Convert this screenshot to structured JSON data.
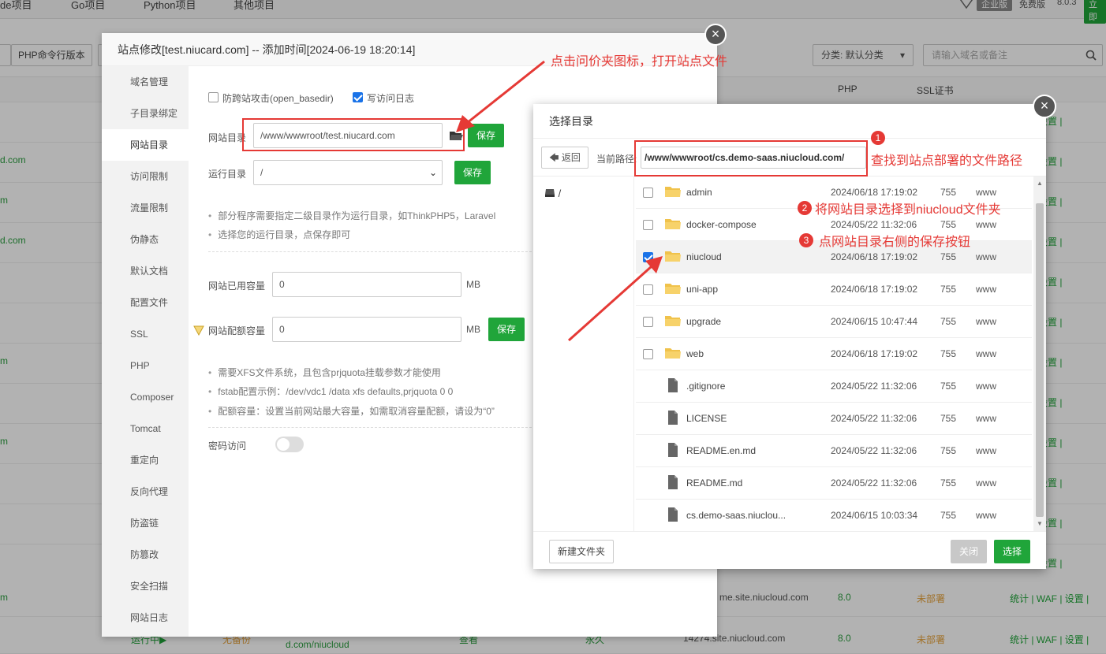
{
  "background": {
    "tabs": [
      "de项目",
      "Go项目",
      "Python项目",
      "其他项目"
    ],
    "edition_badge": "企业版",
    "edition_free": "免费版",
    "version": "8.0.3",
    "upgrade": "立即",
    "php_cli_button": "PHP命令行版本",
    "category_select": "分类: 默认分类",
    "search_placeholder": "请输入域名或备注",
    "col_php": "PHP",
    "col_ssl": "SSL证书",
    "domain_fragments": [
      "d.com",
      "m",
      "d.com",
      "m",
      "m"
    ],
    "row_actions": "WAF | 设置 |",
    "row_actions_full": "统计 | WAF | 设置 |",
    "row1": {
      "domain": "me.site.niucloud.com",
      "php": "8.0",
      "ssl": "未部署"
    },
    "row2": {
      "status": "运行中▶",
      "backup": "无备份",
      "path": "d.com/niucloud",
      "view": "查看",
      "expire": "永久",
      "domain": "14274.site.niucloud.com",
      "php": "8.0",
      "ssl": "未部署"
    },
    "left_m": "m"
  },
  "site_modal": {
    "title": "站点修改[test.niucard.com] -- 添加时间[2024-06-19 18:20:14]",
    "nav": [
      "域名管理",
      "子目录绑定",
      "网站目录",
      "访问限制",
      "流量限制",
      "伪静态",
      "默认文档",
      "配置文件",
      "SSL",
      "PHP",
      "Composer",
      "Tomcat",
      "重定向",
      "反向代理",
      "防盗链",
      "防篡改",
      "安全扫描",
      "网站日志"
    ],
    "active_nav": "网站目录",
    "open_basedir_label": "防跨站攻击(open_basedir)",
    "access_log_label": "写访问日志",
    "site_dir_label": "网站目录",
    "site_dir_value": "/www/wwwroot/test.niucard.com",
    "save": "保存",
    "run_dir_label": "运行目录",
    "run_dir_value": "/",
    "tips1": [
      "部分程序需要指定二级目录作为运行目录，如ThinkPHP5，Laravel",
      "选择您的运行目录，点保存即可"
    ],
    "used_label": "网站已用容量",
    "used_value": "0",
    "quota_label": "网站配额容量",
    "quota_value": "0",
    "unit": "MB",
    "tips2": [
      "需要XFS文件系统，且包含prjquota挂载参数才能使用",
      "fstab配置示例：/dev/vdc1 /data xfs defaults,prjquota 0 0",
      "配额容量：设置当前网站最大容量，如需取消容量配额，请设为“0”"
    ],
    "password_label": "密码访问"
  },
  "dir_modal": {
    "title": "选择目录",
    "back": "返回",
    "path_label": "当前路径:",
    "path_value": "/www/wwwroot/cs.demo-saas.niucloud.com/",
    "tree_root": "/",
    "files": [
      {
        "name": "admin",
        "time": "2024/06/18 17:19:02",
        "perm": "755",
        "owner": "www",
        "type": "folder",
        "checked": false
      },
      {
        "name": "docker-compose",
        "time": "2024/05/22 11:32:06",
        "perm": "755",
        "owner": "www",
        "type": "folder",
        "checked": false
      },
      {
        "name": "niucloud",
        "time": "2024/06/18 17:19:02",
        "perm": "755",
        "owner": "www",
        "type": "folder",
        "checked": true
      },
      {
        "name": "uni-app",
        "time": "2024/06/18 17:19:02",
        "perm": "755",
        "owner": "www",
        "type": "folder",
        "checked": false
      },
      {
        "name": "upgrade",
        "time": "2024/06/15 10:47:44",
        "perm": "755",
        "owner": "www",
        "type": "folder",
        "checked": false
      },
      {
        "name": "web",
        "time": "2024/06/18 17:19:02",
        "perm": "755",
        "owner": "www",
        "type": "folder",
        "checked": false
      },
      {
        "name": ".gitignore",
        "time": "2024/05/22 11:32:06",
        "perm": "755",
        "owner": "www",
        "type": "file",
        "checked": false
      },
      {
        "name": "LICENSE",
        "time": "2024/05/22 11:32:06",
        "perm": "755",
        "owner": "www",
        "type": "file",
        "checked": false
      },
      {
        "name": "README.en.md",
        "time": "2024/05/22 11:32:06",
        "perm": "755",
        "owner": "www",
        "type": "file",
        "checked": false
      },
      {
        "name": "README.md",
        "time": "2024/05/22 11:32:06",
        "perm": "755",
        "owner": "www",
        "type": "file",
        "checked": false
      },
      {
        "name": "cs.demo-saas.niuclou...",
        "time": "2024/06/15 10:03:34",
        "perm": "755",
        "owner": "www",
        "type": "file",
        "checked": false
      }
    ],
    "new_folder": "新建文件夹",
    "close": "关闭",
    "choose": "选择"
  },
  "annotations": {
    "top": "点击问价夹图标，打开站点文件",
    "n1": "1",
    "step1": "查找到站点部署的文件路径",
    "n2": "2",
    "step2": "将网站目录选择到niucloud文件夹",
    "n3": "3",
    "step3": "点网站目录右侧的保存按钮"
  },
  "colors": {
    "accent": "#20a53a",
    "annotation": "#e53935",
    "checkbox": "#1a73e8"
  },
  "icons": {
    "close": "close-icon",
    "folder": "folder-icon",
    "file": "file-icon",
    "drive": "drive-icon",
    "back": "back-arrow-icon",
    "search": "search-icon",
    "diamond": "diamond-icon"
  }
}
